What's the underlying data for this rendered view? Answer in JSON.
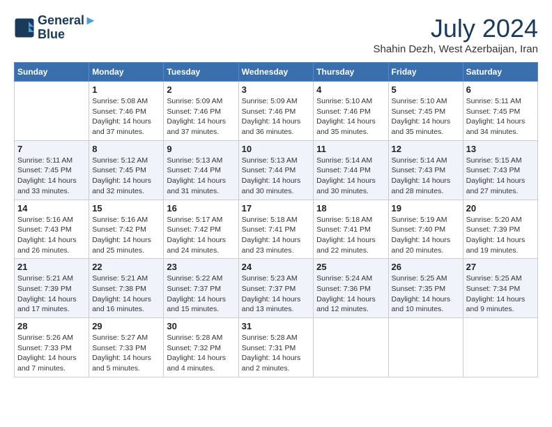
{
  "logo": {
    "line1": "General",
    "line2": "Blue"
  },
  "title": "July 2024",
  "location": "Shahin Dezh, West Azerbaijan, Iran",
  "days_of_week": [
    "Sunday",
    "Monday",
    "Tuesday",
    "Wednesday",
    "Thursday",
    "Friday",
    "Saturday"
  ],
  "weeks": [
    [
      {
        "day": "",
        "info": ""
      },
      {
        "day": "1",
        "info": "Sunrise: 5:08 AM\nSunset: 7:46 PM\nDaylight: 14 hours\nand 37 minutes."
      },
      {
        "day": "2",
        "info": "Sunrise: 5:09 AM\nSunset: 7:46 PM\nDaylight: 14 hours\nand 37 minutes."
      },
      {
        "day": "3",
        "info": "Sunrise: 5:09 AM\nSunset: 7:46 PM\nDaylight: 14 hours\nand 36 minutes."
      },
      {
        "day": "4",
        "info": "Sunrise: 5:10 AM\nSunset: 7:46 PM\nDaylight: 14 hours\nand 35 minutes."
      },
      {
        "day": "5",
        "info": "Sunrise: 5:10 AM\nSunset: 7:45 PM\nDaylight: 14 hours\nand 35 minutes."
      },
      {
        "day": "6",
        "info": "Sunrise: 5:11 AM\nSunset: 7:45 PM\nDaylight: 14 hours\nand 34 minutes."
      }
    ],
    [
      {
        "day": "7",
        "info": "Sunrise: 5:11 AM\nSunset: 7:45 PM\nDaylight: 14 hours\nand 33 minutes."
      },
      {
        "day": "8",
        "info": "Sunrise: 5:12 AM\nSunset: 7:45 PM\nDaylight: 14 hours\nand 32 minutes."
      },
      {
        "day": "9",
        "info": "Sunrise: 5:13 AM\nSunset: 7:44 PM\nDaylight: 14 hours\nand 31 minutes."
      },
      {
        "day": "10",
        "info": "Sunrise: 5:13 AM\nSunset: 7:44 PM\nDaylight: 14 hours\nand 30 minutes."
      },
      {
        "day": "11",
        "info": "Sunrise: 5:14 AM\nSunset: 7:44 PM\nDaylight: 14 hours\nand 30 minutes."
      },
      {
        "day": "12",
        "info": "Sunrise: 5:14 AM\nSunset: 7:43 PM\nDaylight: 14 hours\nand 28 minutes."
      },
      {
        "day": "13",
        "info": "Sunrise: 5:15 AM\nSunset: 7:43 PM\nDaylight: 14 hours\nand 27 minutes."
      }
    ],
    [
      {
        "day": "14",
        "info": "Sunrise: 5:16 AM\nSunset: 7:43 PM\nDaylight: 14 hours\nand 26 minutes."
      },
      {
        "day": "15",
        "info": "Sunrise: 5:16 AM\nSunset: 7:42 PM\nDaylight: 14 hours\nand 25 minutes."
      },
      {
        "day": "16",
        "info": "Sunrise: 5:17 AM\nSunset: 7:42 PM\nDaylight: 14 hours\nand 24 minutes."
      },
      {
        "day": "17",
        "info": "Sunrise: 5:18 AM\nSunset: 7:41 PM\nDaylight: 14 hours\nand 23 minutes."
      },
      {
        "day": "18",
        "info": "Sunrise: 5:18 AM\nSunset: 7:41 PM\nDaylight: 14 hours\nand 22 minutes."
      },
      {
        "day": "19",
        "info": "Sunrise: 5:19 AM\nSunset: 7:40 PM\nDaylight: 14 hours\nand 20 minutes."
      },
      {
        "day": "20",
        "info": "Sunrise: 5:20 AM\nSunset: 7:39 PM\nDaylight: 14 hours\nand 19 minutes."
      }
    ],
    [
      {
        "day": "21",
        "info": "Sunrise: 5:21 AM\nSunset: 7:39 PM\nDaylight: 14 hours\nand 17 minutes."
      },
      {
        "day": "22",
        "info": "Sunrise: 5:21 AM\nSunset: 7:38 PM\nDaylight: 14 hours\nand 16 minutes."
      },
      {
        "day": "23",
        "info": "Sunrise: 5:22 AM\nSunset: 7:37 PM\nDaylight: 14 hours\nand 15 minutes."
      },
      {
        "day": "24",
        "info": "Sunrise: 5:23 AM\nSunset: 7:37 PM\nDaylight: 14 hours\nand 13 minutes."
      },
      {
        "day": "25",
        "info": "Sunrise: 5:24 AM\nSunset: 7:36 PM\nDaylight: 14 hours\nand 12 minutes."
      },
      {
        "day": "26",
        "info": "Sunrise: 5:25 AM\nSunset: 7:35 PM\nDaylight: 14 hours\nand 10 minutes."
      },
      {
        "day": "27",
        "info": "Sunrise: 5:25 AM\nSunset: 7:34 PM\nDaylight: 14 hours\nand 9 minutes."
      }
    ],
    [
      {
        "day": "28",
        "info": "Sunrise: 5:26 AM\nSunset: 7:33 PM\nDaylight: 14 hours\nand 7 minutes."
      },
      {
        "day": "29",
        "info": "Sunrise: 5:27 AM\nSunset: 7:33 PM\nDaylight: 14 hours\nand 5 minutes."
      },
      {
        "day": "30",
        "info": "Sunrise: 5:28 AM\nSunset: 7:32 PM\nDaylight: 14 hours\nand 4 minutes."
      },
      {
        "day": "31",
        "info": "Sunrise: 5:28 AM\nSunset: 7:31 PM\nDaylight: 14 hours\nand 2 minutes."
      },
      {
        "day": "",
        "info": ""
      },
      {
        "day": "",
        "info": ""
      },
      {
        "day": "",
        "info": ""
      }
    ]
  ]
}
